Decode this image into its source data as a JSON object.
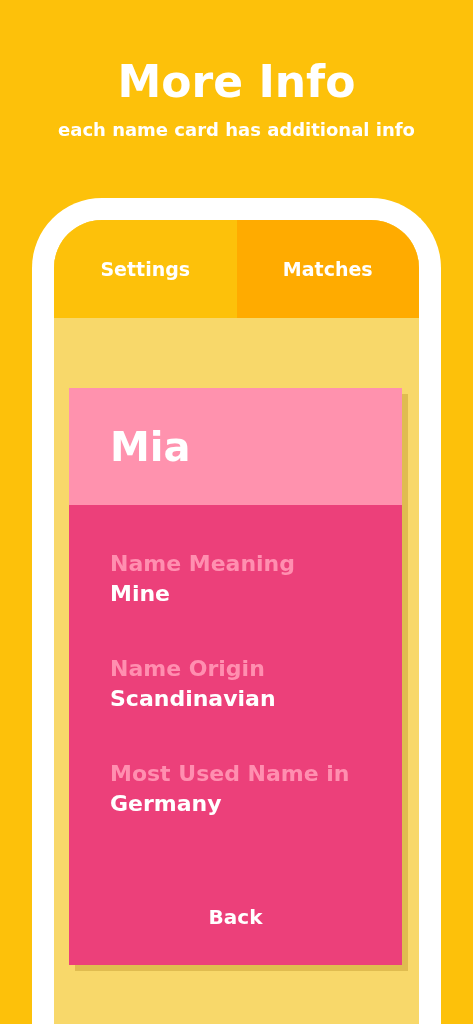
{
  "header": {
    "title": "More Info",
    "subtitle": "each name card has additional info"
  },
  "tabs": [
    {
      "label": "Settings",
      "selected": false
    },
    {
      "label": "Matches",
      "selected": true
    }
  ],
  "card": {
    "name": "Mia",
    "fields": [
      {
        "label": "Name Meaning",
        "value": "Mine"
      },
      {
        "label": "Name Origin",
        "value": "Scandinavian"
      },
      {
        "label": "Most Used Name in",
        "value": "Germany"
      }
    ],
    "button": "Back"
  }
}
